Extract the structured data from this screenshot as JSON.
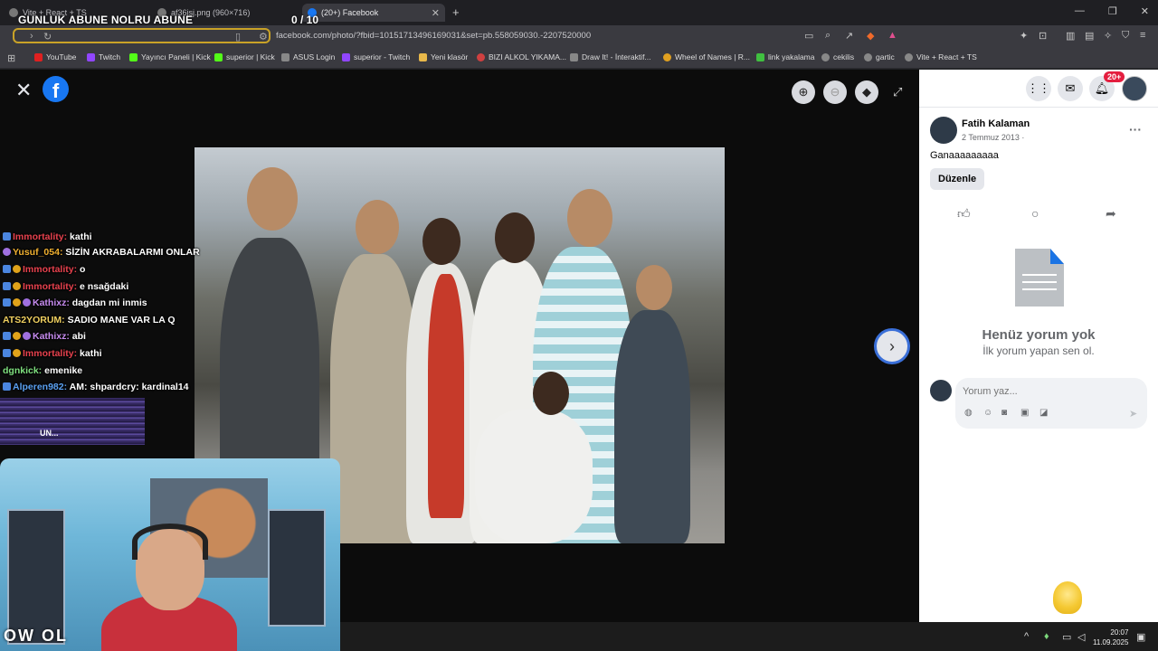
{
  "overlay": {
    "title": "GUNLUK ABUNE NOLRU ABUNE",
    "count": "0  / 10"
  },
  "tabs": [
    {
      "label": "Vite + React + TS"
    },
    {
      "label": "af36jsj.png (960×716)"
    },
    {
      "label": "(20+) Facebook"
    }
  ],
  "address": {
    "url": "facebook.com/photo/?fbid=10151713496169031&set=pb.558059030.-2207520000"
  },
  "bookmarks": [
    {
      "label": "YouTube",
      "color": "#e02020"
    },
    {
      "label": "Twitch",
      "color": "#9146ff"
    },
    {
      "label": "Yayıncı Paneli | Kick",
      "color": "#53fc18"
    },
    {
      "label": "superior | Kick",
      "color": "#53fc18"
    },
    {
      "label": "ASUS Login",
      "color": "#888888"
    },
    {
      "label": "superior - Twitch",
      "color": "#9146ff"
    },
    {
      "label": "Yeni klasör",
      "color": "#e8b84a"
    },
    {
      "label": "BIZI ALKOL YIKAMA...",
      "color": "#d04040"
    },
    {
      "label": "Draw It! - İnteraktif...",
      "color": "#888888"
    },
    {
      "label": "Wheel of Names | R...",
      "color": "#e0a020"
    },
    {
      "label": "link yakalama",
      "color": "#40c040"
    },
    {
      "label": "cekilis",
      "color": "#888888"
    },
    {
      "label": "gartic",
      "color": "#888888"
    },
    {
      "label": "Vite + React + TS",
      "color": "#888888"
    }
  ],
  "chat": [
    {
      "user": "Immortality:",
      "text": "kathi",
      "color": "#e8424e"
    },
    {
      "user": "Yusuf_054:",
      "text": "SİZİN AKRABALARMI ONLAR",
      "color": "#f0b030"
    },
    {
      "user": "Immortality:",
      "text": "o",
      "color": "#e8424e"
    },
    {
      "user": "Immortality:",
      "text": "e nsağdaki",
      "color": "#e8424e"
    },
    {
      "user": "Kathixz:",
      "text": "dagdan mi inmis",
      "color": "#c78cf0"
    },
    {
      "user": "ATS2YORUM:",
      "text": "SADIO MANE VAR LA Q",
      "color": "#f0d060"
    },
    {
      "user": "Kathixz:",
      "text": "abi",
      "color": "#c78cf0"
    },
    {
      "user": "Immortality:",
      "text": "kathi",
      "color": "#e8424e"
    },
    {
      "user": "dgnkick:",
      "text": "emenike",
      "color": "#7fe07f"
    },
    {
      "user": "Alperen982:",
      "text": "AM: shpardcry: kardinal14",
      "color": "#5aa0f0"
    }
  ],
  "chat_glitch_text": "UN...",
  "webcam_tag": "OW OL",
  "panel": {
    "notif_badge": "20+",
    "poster_name": "Fatih Kalaman",
    "poster_date": "2 Temmuz 2013 ·",
    "caption": "Ganaaaaaaaaa",
    "edit_label": "Düzenle",
    "no_comments_title": "Henüz yorum yok",
    "no_comments_sub": "İlk yorum yapan sen ol.",
    "comment_placeholder": "Yorum yaz..."
  },
  "clock": {
    "time": "20:07",
    "date": "11.09.2025"
  },
  "icons": [
    "close-icon",
    "facebook-logo",
    "zoom-in-icon",
    "zoom-out-icon",
    "tag-icon",
    "fullscreen-icon",
    "next-arrow-icon",
    "menu-grid-icon",
    "messenger-icon",
    "bell-icon",
    "like-icon",
    "comment-icon",
    "share-icon",
    "document-icon",
    "emoji-icon",
    "camera-icon",
    "gif-icon",
    "sticker-icon",
    "send-icon"
  ]
}
